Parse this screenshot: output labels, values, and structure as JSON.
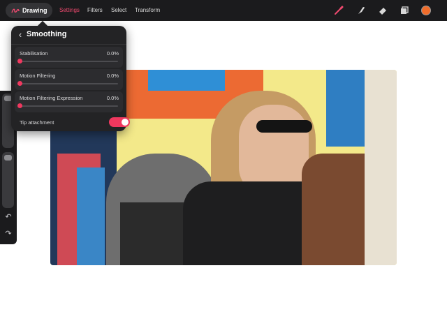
{
  "app": {
    "gallery_label": "Drawing"
  },
  "toolbar": {
    "menus": [
      {
        "label": "Settings",
        "active": true
      },
      {
        "label": "Filters",
        "active": false
      },
      {
        "label": "Select",
        "active": false
      },
      {
        "label": "Transform",
        "active": false
      }
    ],
    "tools": [
      "brush-icon",
      "smudge-icon",
      "eraser-icon",
      "layers-icon"
    ],
    "current_color": "#f06d2b",
    "accent_color": "#f0385f"
  },
  "sidebar": {
    "brush_size": 1.0,
    "opacity": 0.0,
    "undo_icon": "undo-icon",
    "redo_icon": "redo-icon"
  },
  "smoothing_panel": {
    "title": "Smoothing",
    "settings": [
      {
        "label": "Stabilisation",
        "value": "0.0%"
      },
      {
        "label": "Motion Filtering",
        "value": "0.0%"
      },
      {
        "label": "Motion Filtering Expression",
        "value": "0.0%"
      }
    ],
    "tip_attachment": {
      "label": "Tip attachment",
      "enabled": true
    }
  }
}
